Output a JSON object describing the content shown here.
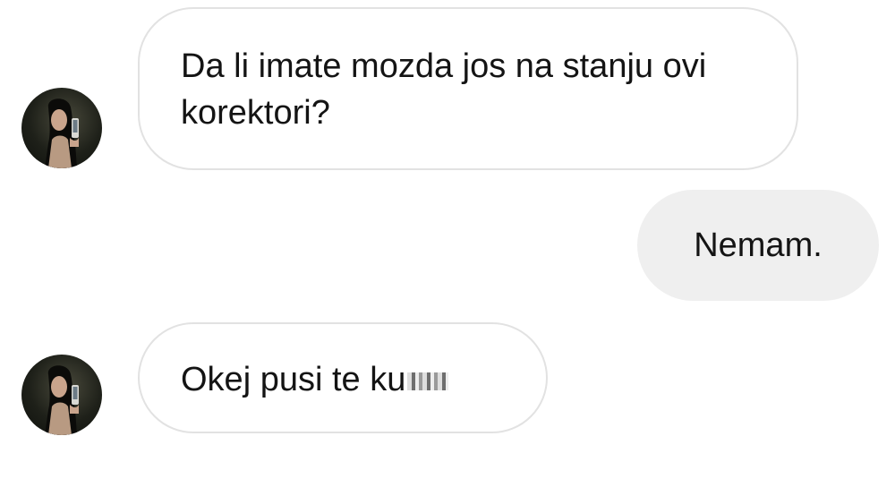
{
  "conversation": {
    "messages": [
      {
        "direction": "incoming",
        "text": "Da li imate mozda jos na stanju ovi korektori?",
        "has_avatar": true
      },
      {
        "direction": "outgoing",
        "text": "Nemam."
      },
      {
        "direction": "incoming",
        "text": "Okej pusi te ku",
        "censored_suffix": true,
        "has_avatar": true
      }
    ]
  },
  "colors": {
    "incoming_bubble_bg": "#ffffff",
    "incoming_bubble_border": "#e2e2e2",
    "outgoing_bubble_bg": "#efefef",
    "text": "#141414",
    "page_bg": "#ffffff"
  },
  "icons": {
    "avatar": "user-profile-photo"
  }
}
